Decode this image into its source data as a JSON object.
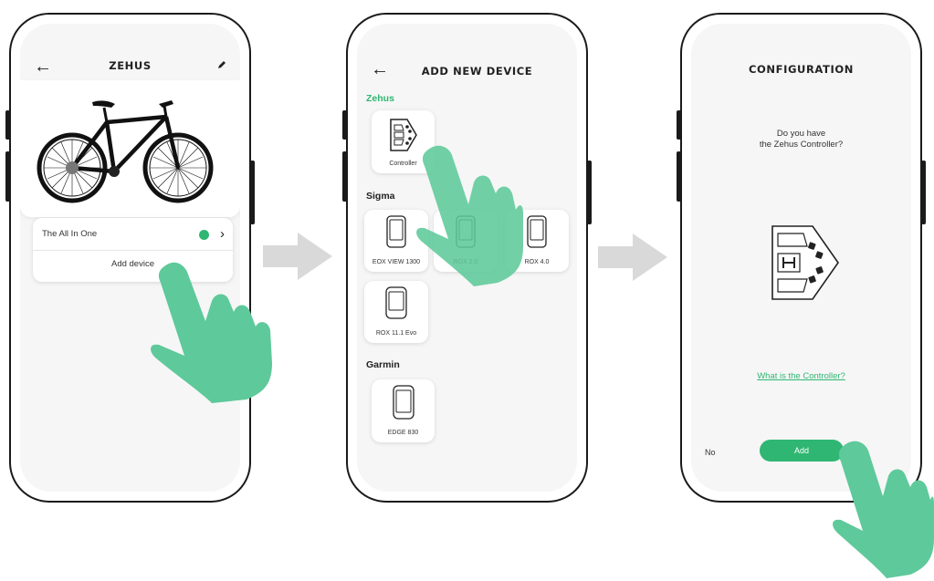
{
  "screen1": {
    "title": "ZEHUS",
    "icons": {
      "back": "back-arrow-icon",
      "edit": "pencil-edit-icon",
      "status": "green-status-dot",
      "chevron": "chevron-right-icon"
    },
    "device_name": "The All In One",
    "add_device_label": "Add device"
  },
  "screen2": {
    "title": "ADD NEW DEVICE",
    "sections": [
      {
        "label": "Zehus",
        "accent": "#2fb672",
        "devices": [
          "Controller"
        ]
      },
      {
        "label": "Sigma",
        "devices": [
          "EOX VIEW 1300",
          "ROX 2.0",
          "ROX 4.0",
          "ROX 11.1 Evo"
        ]
      },
      {
        "label": "Garmin",
        "devices": [
          "EDGE 830"
        ]
      }
    ]
  },
  "screen3": {
    "title": "CONFIGURATION",
    "question_line1": "Do you have",
    "question_line2": "the Zehus Controller?",
    "link": "What is the Controller?",
    "no_label": "No",
    "add_label": "Add"
  },
  "colors": {
    "accent": "#2fb672",
    "hand": "#5ec99a",
    "arrow": "#d9d9d9",
    "frame": "#1a1a1a"
  }
}
